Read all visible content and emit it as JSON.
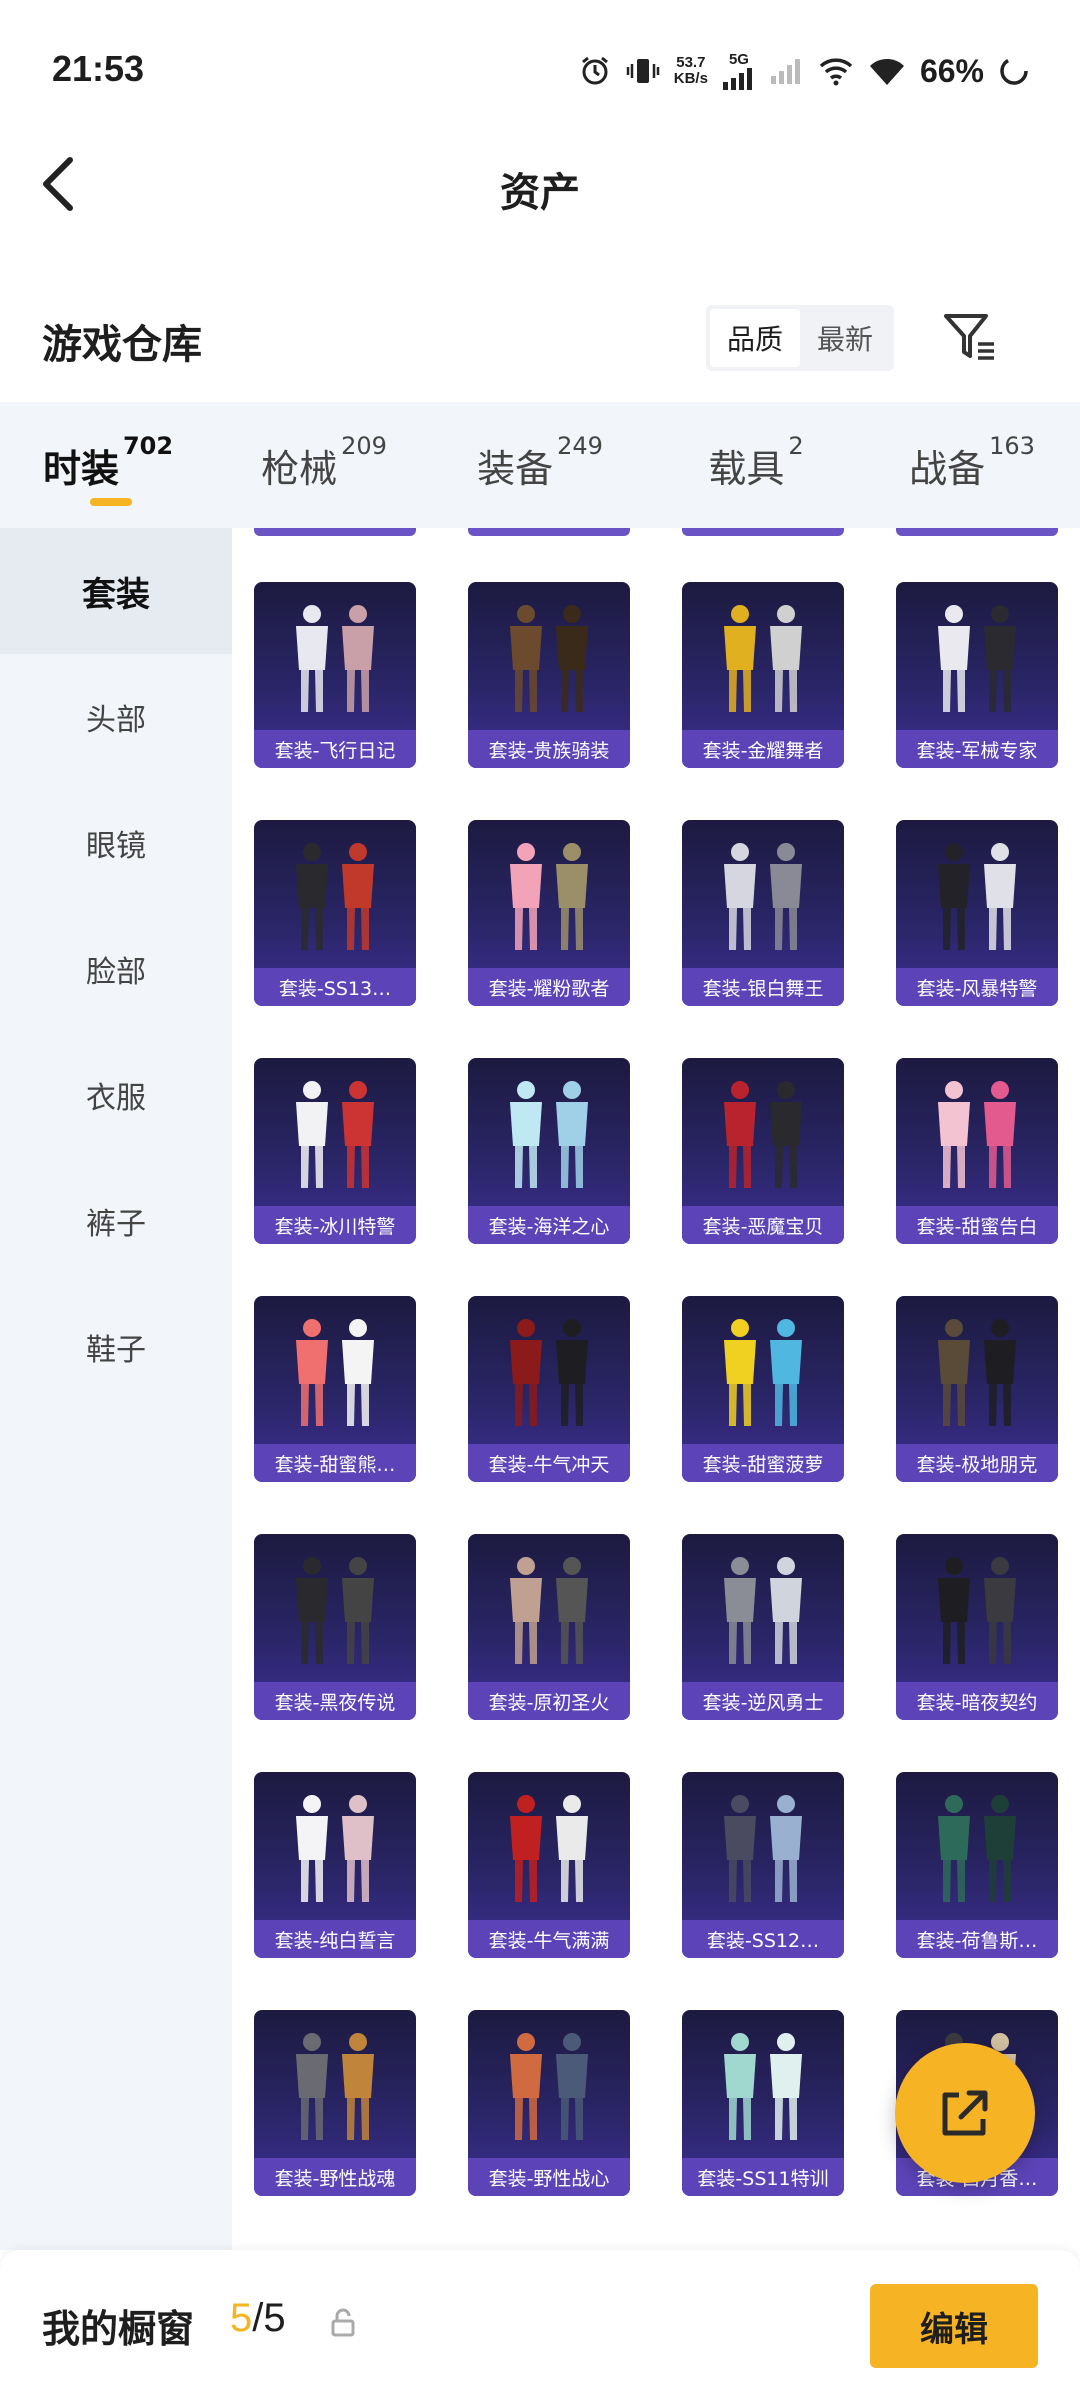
{
  "status_bar": {
    "time": "21:53",
    "net_speed_value": "53.7",
    "net_speed_unit": "KB/s",
    "network": "5G",
    "battery": "66%",
    "icons": [
      "alarm-icon",
      "vibrate-icon",
      "signal-icon",
      "wifi-icon",
      "battery-icon"
    ]
  },
  "header": {
    "title": "资产"
  },
  "section": {
    "title": "游戏仓库",
    "sort_options": [
      "品质",
      "最新"
    ],
    "sort_selected": "品质"
  },
  "tabs": [
    {
      "label": "时装",
      "count": "702"
    },
    {
      "label": "枪械",
      "count": "209"
    },
    {
      "label": "装备",
      "count": "249"
    },
    {
      "label": "载具",
      "count": "2"
    },
    {
      "label": "战备",
      "count": "163"
    }
  ],
  "sidebar": [
    "套装",
    "头部",
    "眼镜",
    "脸部",
    "衣服",
    "裤子",
    "鞋子"
  ],
  "items": [
    "套装-飞行日记",
    "套装-贵族骑装",
    "套装-金耀舞者",
    "套装-军械专家",
    "套装-SS13…",
    "套装-耀粉歌者",
    "套装-银白舞王",
    "套装-风暴特警",
    "套装-冰川特警",
    "套装-海洋之心",
    "套装-恶魔宝贝",
    "套装-甜蜜告白",
    "套装-甜蜜熊…",
    "套装-牛气冲天",
    "套装-甜蜜菠萝",
    "套装-极地朋克",
    "套装-黑夜传说",
    "套装-原初圣火",
    "套装-逆风勇士",
    "套装-暗夜契约",
    "套装-纯白誓言",
    "套装-牛气满满",
    "套装-SS12…",
    "套装-荷鲁斯…",
    "套装-野性战魂",
    "套装-野性战心",
    "套装-SS11特训",
    "套装-白月香…"
  ],
  "bottom": {
    "label": "我的橱窗",
    "current": "5",
    "separator": "/",
    "total": "5",
    "edit_label": "编辑"
  },
  "colors": {
    "accent": "#f6b324",
    "card_label": "#5c44b8"
  }
}
